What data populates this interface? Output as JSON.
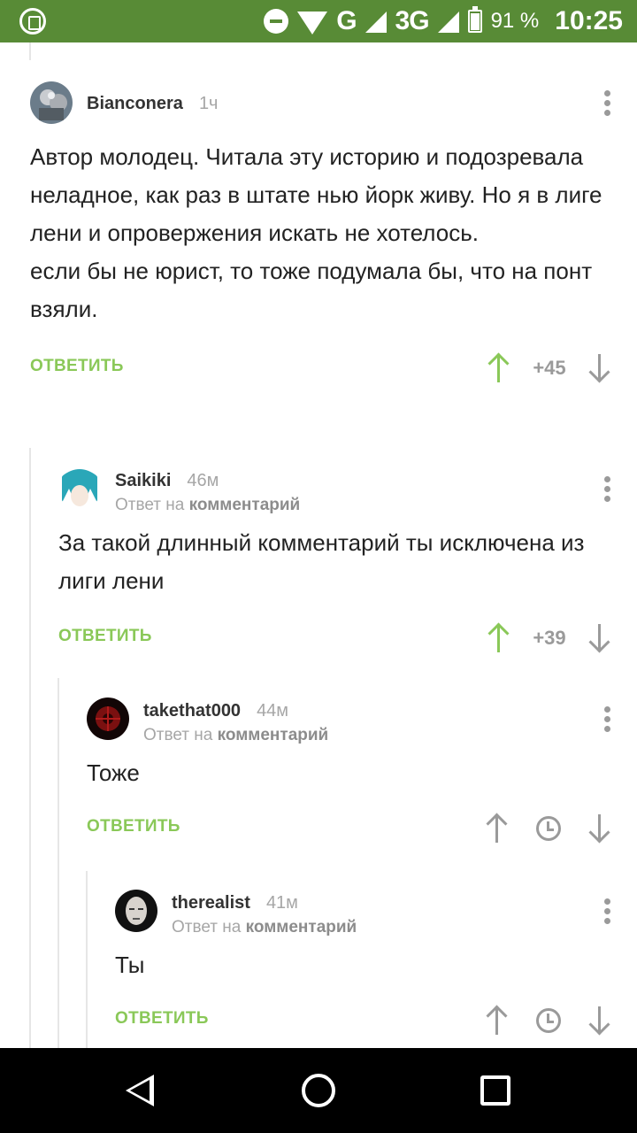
{
  "status_bar": {
    "battery": "91 %",
    "time": "10:25",
    "network_g": "G",
    "network_3g": "3G",
    "icons": [
      "app-notification-icon",
      "dnd-icon",
      "wifi-icon",
      "signal-icon",
      "battery-icon"
    ]
  },
  "reply_label": "ОТВЕТИТЬ",
  "reply_to_prefix": "Ответ на",
  "reply_to_link": "комментарий",
  "comments": [
    {
      "author": "Bianconera",
      "time": "1ч",
      "text": "Автор молодец. Читала эту историю и подозревала неладное, как раз в штате нью йорк живу. Но я в лиге лени и опровержения искать не хотелось.\nесли бы не юрист, то тоже подумала бы, что на понт взяли.",
      "rating": "+45",
      "depth": 0
    },
    {
      "author": "Saikiki",
      "time": "46м",
      "text": "За такой длинный комментарий ты исключена из лиги лени",
      "rating": "+39",
      "depth": 1
    },
    {
      "author": "takethat000",
      "time": "44м",
      "text": "Тоже",
      "rating": "",
      "depth": 2
    },
    {
      "author": "therealist",
      "time": "41м",
      "text": "Ты",
      "rating": "",
      "depth": 3
    }
  ],
  "colors": {
    "status_bar": "#588b36",
    "accent_green": "#8ac858",
    "muted_grey": "#9a9a9a",
    "nav_bar": "#000000"
  }
}
